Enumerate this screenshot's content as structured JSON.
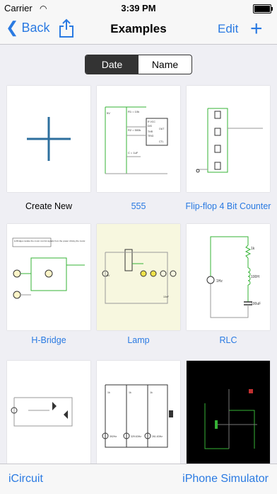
{
  "status": {
    "carrier": "Carrier",
    "time": "3:39 PM"
  },
  "nav": {
    "back_label": "Back",
    "title": "Examples",
    "edit_label": "Edit",
    "add_label": "+"
  },
  "segments": {
    "date": "Date",
    "name": "Name",
    "selected": "Date"
  },
  "examples": [
    {
      "label": "Create New"
    },
    {
      "label": "555"
    },
    {
      "label": "Flip-flop 4 Bit Counter"
    },
    {
      "label": "H-Bridge"
    },
    {
      "label": "Lamp"
    },
    {
      "label": "RLC"
    }
  ],
  "thumb_text": {
    "c555_r1": "R1 = 10k",
    "c555_r2": "R2 = 500k",
    "c555_c": "C = 1uF",
    "c555_v": "5V",
    "c555_rvcc": "R VCC",
    "c555_dis": "DIS",
    "c555_out": "OUT",
    "c555_thr": "THR",
    "c555_trig": "TRIG",
    "c555_ctl": "CTL",
    "rlc_r": "1k",
    "rlc_l": "100H",
    "rlc_c": "100uF",
    "rlc_src": "1Hz",
    "hb_note": "H-Bridges isolate the motor control signals from the power driving the motor.",
    "lamp_v": "5V",
    "lamp_c": "10nF",
    "r7_1": "1k",
    "r7_2": "1k",
    "r7_3": "1k",
    "r7_f1": "392Hz",
    "r7_f2": "329.63Hz",
    "r7_f3": "261.63Hz"
  },
  "toolbar": {
    "left": "iCircuit",
    "right": "iPhone Simulator"
  },
  "colors": {
    "accent": "#2a7ae2",
    "wire_green": "#36b336",
    "lamp_bg": "#f7f7df",
    "scope_bg": "#000000"
  }
}
